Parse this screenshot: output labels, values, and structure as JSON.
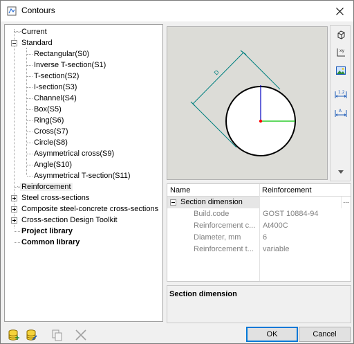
{
  "window": {
    "title": "Contours"
  },
  "tree": {
    "items": [
      {
        "label": "Current",
        "level": 1,
        "expander": "none",
        "bold": false
      },
      {
        "label": "Standard",
        "level": 1,
        "expander": "minus",
        "bold": false
      },
      {
        "label": "Rectangular(S0)",
        "level": 2,
        "expander": "none",
        "bold": false
      },
      {
        "label": "Inverse T-section(S1)",
        "level": 2,
        "expander": "none",
        "bold": false
      },
      {
        "label": "T-section(S2)",
        "level": 2,
        "expander": "none",
        "bold": false
      },
      {
        "label": "I-section(S3)",
        "level": 2,
        "expander": "none",
        "bold": false
      },
      {
        "label": "Channel(S4)",
        "level": 2,
        "expander": "none",
        "bold": false
      },
      {
        "label": "Box(S5)",
        "level": 2,
        "expander": "none",
        "bold": false
      },
      {
        "label": "Ring(S6)",
        "level": 2,
        "expander": "none",
        "bold": false
      },
      {
        "label": "Cross(S7)",
        "level": 2,
        "expander": "none",
        "bold": false
      },
      {
        "label": "Circle(S8)",
        "level": 2,
        "expander": "none",
        "bold": false
      },
      {
        "label": "Asymmetrical cross(S9)",
        "level": 2,
        "expander": "none",
        "bold": false
      },
      {
        "label": "Angle(S10)",
        "level": 2,
        "expander": "none",
        "bold": false
      },
      {
        "label": "Asymmetrical T-section(S11)",
        "level": 2,
        "expander": "none",
        "bold": false
      },
      {
        "label": "Reinforcement",
        "level": 1,
        "expander": "none",
        "bold": false,
        "selected": true
      },
      {
        "label": "Steel cross-sections",
        "level": 1,
        "expander": "plus",
        "bold": false
      },
      {
        "label": "Composite steel-concrete cross-sections",
        "level": 1,
        "expander": "plus",
        "bold": false
      },
      {
        "label": "Cross-section Design Toolkit",
        "level": 1,
        "expander": "plus",
        "bold": false
      },
      {
        "label": "Project library",
        "level": 1,
        "expander": "none",
        "bold": true
      },
      {
        "label": "Common library",
        "level": 1,
        "expander": "none",
        "bold": true
      }
    ]
  },
  "preview": {
    "dimension_label": "D"
  },
  "side_toolbar": {
    "icons": [
      "cube-icon",
      "coordinate-axes-icon",
      "image-icon",
      "dimension-icon",
      "text-dimension-icon",
      "scroll-down-icon"
    ]
  },
  "properties": {
    "header_name": "Name",
    "header_value": "Reinforcement",
    "category": "Section dimension",
    "ellipsis": "...",
    "rows": [
      {
        "name": "Build.code",
        "value": "GOST 10884-94"
      },
      {
        "name": "Reinforcement c...",
        "value": "At400C"
      },
      {
        "name": "Diameter, mm",
        "value": "6"
      },
      {
        "name": "Reinforcement t...",
        "value": "variable"
      }
    ]
  },
  "description": {
    "title": "Section dimension"
  },
  "buttons": {
    "ok": "OK",
    "cancel": "Cancel"
  },
  "colors": {
    "contour": "#008080",
    "axis_y": "#0000c0",
    "axis_x": "#00c000",
    "origin": "#ff0000",
    "preview_bg": "#dcdcd7"
  }
}
